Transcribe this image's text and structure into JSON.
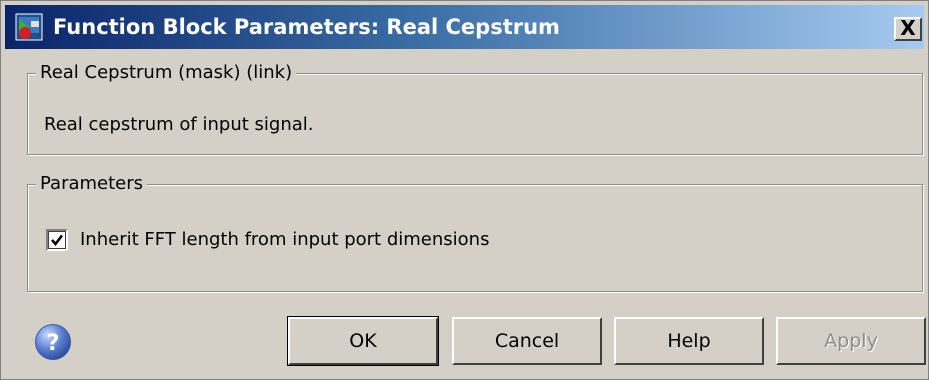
{
  "window": {
    "title": "Function Block Parameters: Real Cepstrum",
    "close_label": "X"
  },
  "description_group": {
    "label": "Real Cepstrum (mask) (link)",
    "text": "Real cepstrum of input signal."
  },
  "parameters_group": {
    "label": "Parameters",
    "inherit_fft_checkbox": {
      "label": "Inherit FFT length from input port dimensions",
      "checked": true
    }
  },
  "footer": {
    "help_icon": "question-mark-icon",
    "buttons": {
      "ok": "OK",
      "cancel": "Cancel",
      "help": "Help",
      "apply": "Apply",
      "apply_enabled": false
    }
  },
  "colors": {
    "dialog_background": "#d4d0c8",
    "titlebar_start": "#0a246a",
    "titlebar_end": "#a6caf0",
    "title_text": "#ffffff",
    "disabled_text": "#8c8c8c"
  }
}
